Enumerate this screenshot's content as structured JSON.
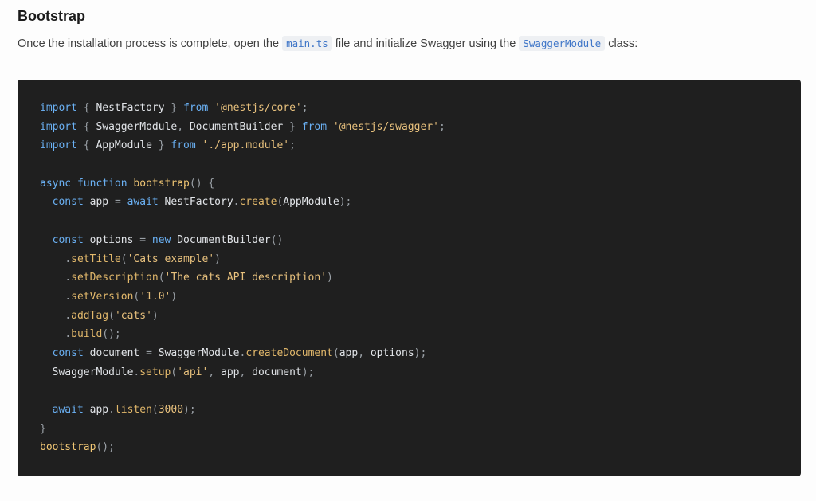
{
  "heading": "Bootstrap",
  "intro": {
    "before": "Once the installation process is complete, open the ",
    "file": "main.ts",
    "middle": " file and initialize Swagger using the ",
    "class_name": "SwaggerModule",
    "after": " class:"
  },
  "code_lines": [
    [
      [
        "kw",
        "import"
      ],
      [
        "punct",
        " { "
      ],
      [
        "plain",
        "NestFactory"
      ],
      [
        "punct",
        " } "
      ],
      [
        "kw",
        "from"
      ],
      [
        "plain",
        " "
      ],
      [
        "str",
        "'@nestjs/core'"
      ],
      [
        "punct",
        ";"
      ]
    ],
    [
      [
        "kw",
        "import"
      ],
      [
        "punct",
        " { "
      ],
      [
        "plain",
        "SwaggerModule"
      ],
      [
        "punct",
        ", "
      ],
      [
        "plain",
        "DocumentBuilder"
      ],
      [
        "punct",
        " } "
      ],
      [
        "kw",
        "from"
      ],
      [
        "plain",
        " "
      ],
      [
        "str",
        "'@nestjs/swagger'"
      ],
      [
        "punct",
        ";"
      ]
    ],
    [
      [
        "kw",
        "import"
      ],
      [
        "punct",
        " { "
      ],
      [
        "plain",
        "AppModule"
      ],
      [
        "punct",
        " } "
      ],
      [
        "kw",
        "from"
      ],
      [
        "plain",
        " "
      ],
      [
        "str",
        "'./app.module'"
      ],
      [
        "punct",
        ";"
      ]
    ],
    [],
    [
      [
        "kw",
        "async"
      ],
      [
        "plain",
        " "
      ],
      [
        "kw",
        "function"
      ],
      [
        "plain",
        " "
      ],
      [
        "fn",
        "bootstrap"
      ],
      [
        "punct",
        "() {"
      ]
    ],
    [
      [
        "plain",
        "  "
      ],
      [
        "kw",
        "const"
      ],
      [
        "plain",
        " app "
      ],
      [
        "punct",
        "= "
      ],
      [
        "kw",
        "await"
      ],
      [
        "plain",
        " NestFactory"
      ],
      [
        "punct",
        "."
      ],
      [
        "meth",
        "create"
      ],
      [
        "punct",
        "("
      ],
      [
        "plain",
        "AppModule"
      ],
      [
        "punct",
        ");"
      ]
    ],
    [],
    [
      [
        "plain",
        "  "
      ],
      [
        "kw",
        "const"
      ],
      [
        "plain",
        " options "
      ],
      [
        "punct",
        "= "
      ],
      [
        "kw",
        "new"
      ],
      [
        "plain",
        " DocumentBuilder"
      ],
      [
        "punct",
        "()"
      ]
    ],
    [
      [
        "plain",
        "    "
      ],
      [
        "punct",
        "."
      ],
      [
        "meth",
        "setTitle"
      ],
      [
        "punct",
        "("
      ],
      [
        "str",
        "'Cats example'"
      ],
      [
        "punct",
        ")"
      ]
    ],
    [
      [
        "plain",
        "    "
      ],
      [
        "punct",
        "."
      ],
      [
        "meth",
        "setDescription"
      ],
      [
        "punct",
        "("
      ],
      [
        "str",
        "'The cats API description'"
      ],
      [
        "punct",
        ")"
      ]
    ],
    [
      [
        "plain",
        "    "
      ],
      [
        "punct",
        "."
      ],
      [
        "meth",
        "setVersion"
      ],
      [
        "punct",
        "("
      ],
      [
        "str",
        "'1.0'"
      ],
      [
        "punct",
        ")"
      ]
    ],
    [
      [
        "plain",
        "    "
      ],
      [
        "punct",
        "."
      ],
      [
        "meth",
        "addTag"
      ],
      [
        "punct",
        "("
      ],
      [
        "str",
        "'cats'"
      ],
      [
        "punct",
        ")"
      ]
    ],
    [
      [
        "plain",
        "    "
      ],
      [
        "punct",
        "."
      ],
      [
        "meth",
        "build"
      ],
      [
        "punct",
        "();"
      ]
    ],
    [
      [
        "plain",
        "  "
      ],
      [
        "kw",
        "const"
      ],
      [
        "plain",
        " document "
      ],
      [
        "punct",
        "= "
      ],
      [
        "plain",
        "SwaggerModule"
      ],
      [
        "punct",
        "."
      ],
      [
        "meth",
        "createDocument"
      ],
      [
        "punct",
        "("
      ],
      [
        "plain",
        "app"
      ],
      [
        "punct",
        ", "
      ],
      [
        "plain",
        "options"
      ],
      [
        "punct",
        ");"
      ]
    ],
    [
      [
        "plain",
        "  SwaggerModule"
      ],
      [
        "punct",
        "."
      ],
      [
        "meth",
        "setup"
      ],
      [
        "punct",
        "("
      ],
      [
        "str",
        "'api'"
      ],
      [
        "punct",
        ", "
      ],
      [
        "plain",
        "app"
      ],
      [
        "punct",
        ", "
      ],
      [
        "plain",
        "document"
      ],
      [
        "punct",
        ");"
      ]
    ],
    [],
    [
      [
        "plain",
        "  "
      ],
      [
        "kw",
        "await"
      ],
      [
        "plain",
        " app"
      ],
      [
        "punct",
        "."
      ],
      [
        "meth",
        "listen"
      ],
      [
        "punct",
        "("
      ],
      [
        "str",
        "3000"
      ],
      [
        "punct",
        ");"
      ]
    ],
    [
      [
        "punct",
        "}"
      ]
    ],
    [
      [
        "fn",
        "bootstrap"
      ],
      [
        "punct",
        "();"
      ]
    ]
  ]
}
